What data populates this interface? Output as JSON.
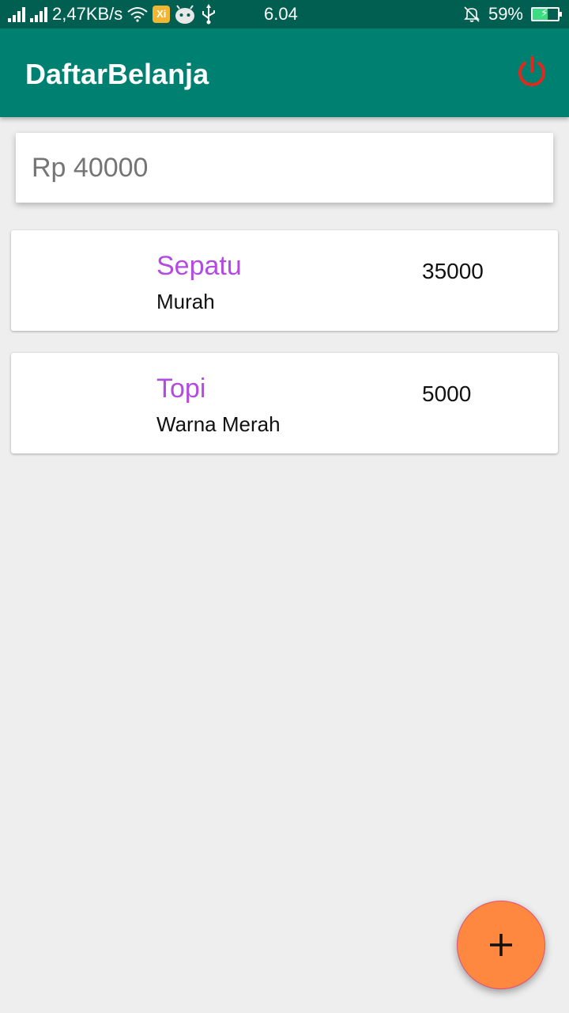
{
  "status_bar": {
    "net_speed": "2,47KB/s",
    "time": "6.04",
    "battery": "59%",
    "app_badge": "Xi",
    "battery_level": 0.59,
    "icons": [
      "signal-icon",
      "wifi-icon",
      "app-icon",
      "android-icon",
      "usb-icon",
      "mute-icon",
      "battery-icon"
    ]
  },
  "app_bar": {
    "title": "DaftarBelanja",
    "action_icon": "power-icon",
    "background": "#008070",
    "action_color": "#e0291c"
  },
  "budget": {
    "placeholder": "Rp 40000",
    "value": ""
  },
  "items": [
    {
      "name": "Sepatu",
      "description": "Murah",
      "price": "35000"
    },
    {
      "name": "Topi",
      "description": "Warna Merah",
      "price": "5000"
    }
  ],
  "fab": {
    "icon": "plus-icon",
    "color": "#ff8840"
  },
  "colors": {
    "item_name": "#b44be0",
    "background": "#eeeeee"
  }
}
